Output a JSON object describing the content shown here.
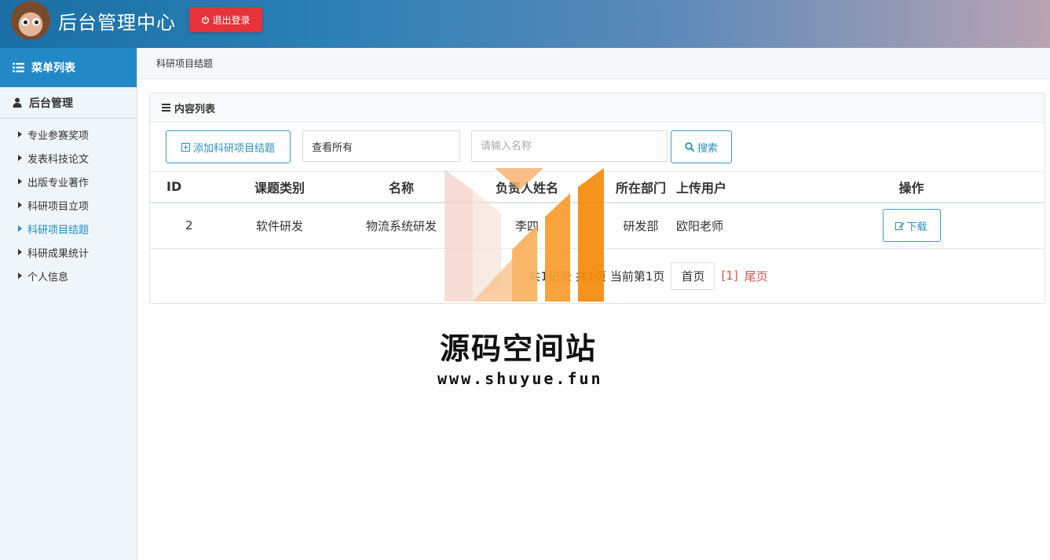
{
  "header": {
    "title": "后台管理中心",
    "logout_label": "退出登录"
  },
  "sidebar": {
    "menu_title": "菜单列表",
    "group_title": "后台管理",
    "items": [
      {
        "label": "专业参赛奖项",
        "active": false
      },
      {
        "label": "发表科技论文",
        "active": false
      },
      {
        "label": "出版专业著作",
        "active": false
      },
      {
        "label": "科研项目立项",
        "active": false
      },
      {
        "label": "科研项目结题",
        "active": true
      },
      {
        "label": "科研成果统计",
        "active": false
      },
      {
        "label": "个人信息",
        "active": false
      }
    ]
  },
  "breadcrumb": "科研项目结题",
  "panel": {
    "title": "内容列表",
    "add_label": "添加科研项目结题",
    "filter_value": "查看所有",
    "search_placeholder": "请输入名称",
    "search_label": "搜索"
  },
  "table": {
    "headers": [
      "ID",
      "课题类别",
      "名称",
      "负责人姓名",
      "所在部门",
      "上传用户",
      "操作"
    ],
    "rows": [
      {
        "id": "2",
        "category": "软件研发",
        "name": "物流系统研发",
        "leader": "李四",
        "dept": "研发部",
        "user": "欧阳老师",
        "action": "下载"
      }
    ]
  },
  "pagination": {
    "summary": "共1记录 共1页 当前第1页",
    "first": "首页",
    "current": "[1]",
    "last": "尾页"
  },
  "watermark": {
    "name": "源码空间站",
    "url": "www.shuyue.fun"
  },
  "colors": {
    "accent": "#2389c6",
    "danger": "#e5323b",
    "link": "#2b8fbf"
  }
}
